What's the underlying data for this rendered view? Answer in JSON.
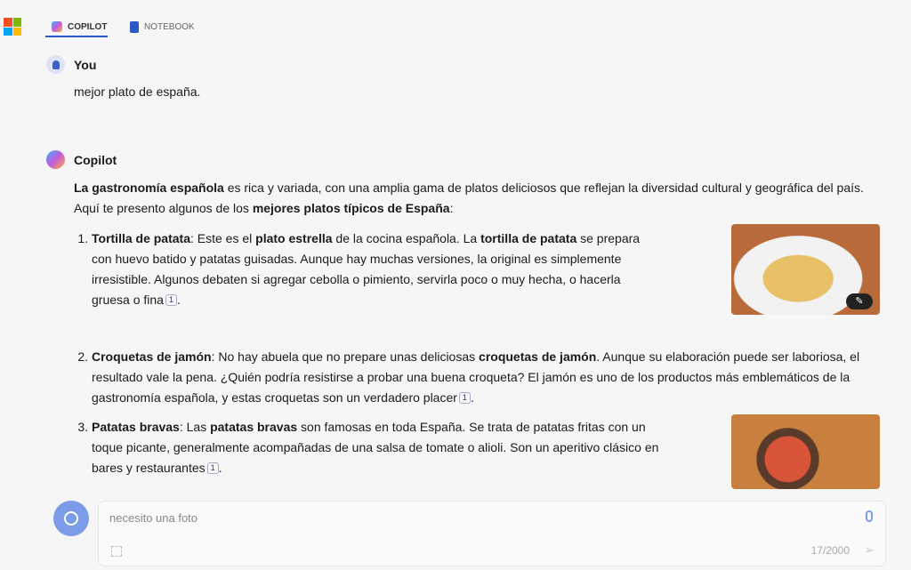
{
  "tabs": [
    {
      "label": "COPILOT",
      "active": true
    },
    {
      "label": "NOTEBOOK",
      "active": false
    }
  ],
  "user": {
    "name": "You",
    "message": "mejor plato de españa."
  },
  "bot": {
    "name": "Copilot",
    "intro": {
      "b1": "La gastronomía española",
      "t1": " es rica y variada, con una amplia gama de platos deliciosos que reflejan la diversidad cultural y geográfica del país. Aquí te presento algunos de los ",
      "b2": "mejores platos típicos de España",
      "t2": ":"
    },
    "items": [
      {
        "title": "Tortilla de patata",
        "parts": [
          ": Este es el ",
          "plato estrella",
          " de la cocina española. La ",
          "tortilla de patata",
          " se prepara con huevo batido y patatas guisadas. Aunque hay muchas versiones, la original es simplemente irresistible. Algunos debaten si agregar cebolla o pimiento, servirla poco o muy hecha, o hacerla gruesa o fina"
        ],
        "ref": "1",
        "image": "tortilla-photo"
      },
      {
        "title": "Croquetas de jamón",
        "parts": [
          ": No hay abuela que no prepare unas deliciosas ",
          "croquetas de jamón",
          ". Aunque su elaboración puede ser laboriosa, el resultado vale la pena. ¿Quién podría resistirse a probar una buena croqueta? El jamón es uno de los productos más emblemáticos de la gastronomía española, y estas croquetas son un verdadero placer"
        ],
        "ref": "1"
      },
      {
        "title": "Patatas bravas",
        "parts": [
          ": Las ",
          "patatas bravas",
          " son famosas en toda España. Se trata de patatas fritas con un toque picante, generalmente acompañadas de una salsa de tomate o alioli. Son un aperitivo clásico en bares y restaurantes"
        ],
        "ref": "1",
        "image": "patatas-bravas-photo"
      }
    ]
  },
  "composer": {
    "value": "necesito una foto",
    "counter": "17/2000"
  },
  "colors": {
    "accent": "#2a58c9",
    "newchat": "#7c9be8"
  }
}
